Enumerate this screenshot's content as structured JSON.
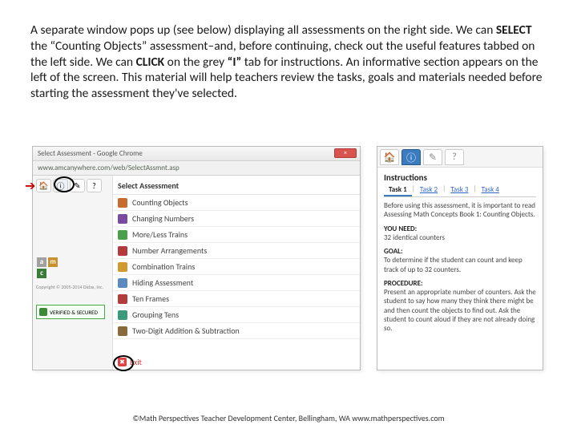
{
  "paragraph_html": "A separate window pops up (see below) displaying all assessments on the right side. We can <b>SELECT</b> the “Counting Objects” assessment–and, before continuing,  check out the useful features tabbed on the left side. We can  <b>CLICK</b> on the grey <b>“I”</b> tab for instructions. An informative section appears on the left of the screen. This material will help teachers review the tasks, goals and materials needed before starting the assessment they've selected.",
  "browser": {
    "title": "Select Assessment - Google Chrome",
    "close_label": "×",
    "url": "www.amcanywhere.com/web/SelectAssmnt.asp",
    "select_header": "Select Assessment",
    "assessments": [
      {
        "label": "Counting Objects",
        "color": "#c86b2e"
      },
      {
        "label": "Changing Numbers",
        "color": "#7a4aa0"
      },
      {
        "label": "More/Less Trains",
        "color": "#4aa04a"
      },
      {
        "label": "Number Arrangements",
        "color": "#b33b3b"
      },
      {
        "label": "Combination Trains",
        "color": "#d29a2e"
      },
      {
        "label": "Hiding Assessment",
        "color": "#5a8ac0"
      },
      {
        "label": "Ten Frames",
        "color": "#b33b3b"
      },
      {
        "label": "Grouping Tens",
        "color": "#3a9a7a"
      },
      {
        "label": "Two-Digit Addition & Subtraction",
        "color": "#8a6a3a"
      }
    ],
    "exit_label": "Exit",
    "amc_letters": [
      "a",
      "m",
      "c"
    ],
    "amc_colors": [
      "#a0a0a0",
      "#c7912e",
      "#3a7a3a"
    ],
    "copyright_tiny": "Copyright © 2005-2014 Didax, Inc.",
    "verified_label": "VERIFIED & SECURED"
  },
  "info_panel": {
    "heading": "Instructions",
    "tabs": [
      "Task 1",
      "Task 2",
      "Task 3",
      "Task 4"
    ],
    "active_tab": 0,
    "body": {
      "intro": "Before using this assessment, it is important to read Assessing Math Concepts Book 1: Counting Objects.",
      "need_label": "YOU NEED:",
      "need_text": "32 identical counters",
      "goal_label": "GOAL:",
      "goal_text": "To determine if the student can count and keep track of up to 32 counters.",
      "proc_label": "PROCEDURE:",
      "proc_text": "Present an appropriate number of counters. Ask the student to say how many they think there might be and then count the objects to find out. Ask the student to count aloud if they are not already doing so."
    }
  },
  "footer": "©Math Perspectives  Teacher Development Center, Bellingham, WA  www.mathperspectives.com"
}
